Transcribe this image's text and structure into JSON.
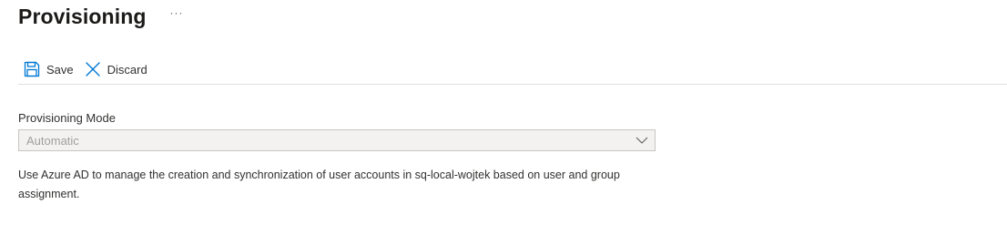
{
  "header": {
    "title": "Provisioning",
    "more_label": "···"
  },
  "toolbar": {
    "save_label": "Save",
    "discard_label": "Discard",
    "save_icon": "save-icon",
    "discard_icon": "close-icon",
    "accent_color": "#0078d4"
  },
  "form": {
    "provisioning_mode": {
      "label": "Provisioning Mode",
      "selected_value": "Automatic",
      "disabled": true
    },
    "description": "Use Azure AD to manage the creation and synchronization of user accounts in sq-local-wojtek based on user and group assignment."
  }
}
